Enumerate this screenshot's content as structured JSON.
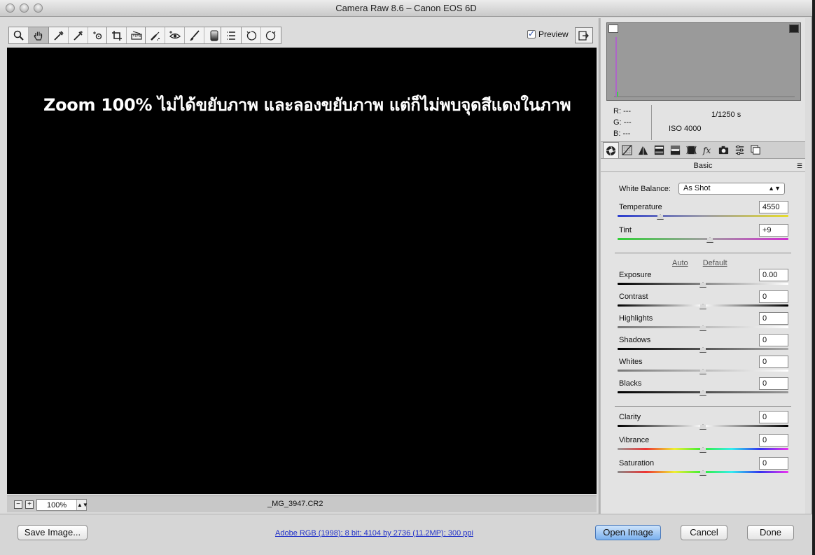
{
  "window": {
    "title": "Camera Raw 8.6  –  Canon EOS 6D"
  },
  "toolbar": {
    "tools": [
      {
        "name": "zoom-tool-icon"
      },
      {
        "name": "hand-tool-icon"
      },
      {
        "name": "white-balance-tool-icon"
      },
      {
        "name": "color-sampler-tool-icon"
      },
      {
        "name": "targeted-adjustment-tool-icon"
      },
      {
        "name": "crop-tool-icon"
      },
      {
        "name": "straighten-tool-icon"
      },
      {
        "name": "spot-removal-tool-icon"
      },
      {
        "name": "red-eye-removal-tool-icon"
      },
      {
        "name": "adjustment-brush-icon"
      },
      {
        "name": "graduated-filter-icon"
      },
      {
        "name": "preferences-icon"
      },
      {
        "name": "rotate-ccw-icon"
      },
      {
        "name": "rotate-cw-icon"
      }
    ],
    "preview_label": "Preview",
    "preview_checked": true
  },
  "canvas": {
    "overlay_text": "Zoom 100% ไม่ได้ขยับภาพ และลองขยับภาพ แต่ก็ไม่พบจุดสีแดงในภาพ",
    "background": "#000000"
  },
  "statusbar": {
    "zoom_out": "−",
    "zoom_in": "+",
    "zoom_value": "100%",
    "filename": "_MG_3947.CR2"
  },
  "histogram": {
    "r_label": "R:",
    "r_value": "---",
    "g_label": "G:",
    "g_value": "---",
    "b_label": "B:",
    "b_value": "---",
    "shutter": "1/1250 s",
    "iso": "ISO 4000"
  },
  "panel": {
    "title": "Basic",
    "tabs": [
      {
        "name": "basic-tab-icon"
      },
      {
        "name": "tone-curve-tab-icon"
      },
      {
        "name": "detail-tab-icon"
      },
      {
        "name": "hsl-tab-icon"
      },
      {
        "name": "split-toning-tab-icon"
      },
      {
        "name": "lens-corrections-tab-icon"
      },
      {
        "name": "effects-tab-icon"
      },
      {
        "name": "camera-calibration-tab-icon"
      },
      {
        "name": "presets-tab-icon"
      },
      {
        "name": "snapshots-tab-icon"
      }
    ],
    "white_balance_label": "White Balance:",
    "white_balance_value": "As Shot",
    "auto_label": "Auto",
    "default_label": "Default",
    "sliders": [
      {
        "label": "Temperature",
        "value": "4550",
        "pos": 0.25
      },
      {
        "label": "Tint",
        "value": "+9",
        "pos": 0.54
      },
      {
        "label": "Exposure",
        "value": "0.00",
        "pos": 0.5
      },
      {
        "label": "Contrast",
        "value": "0",
        "pos": 0.5
      },
      {
        "label": "Highlights",
        "value": "0",
        "pos": 0.5
      },
      {
        "label": "Shadows",
        "value": "0",
        "pos": 0.5
      },
      {
        "label": "Whites",
        "value": "0",
        "pos": 0.5
      },
      {
        "label": "Blacks",
        "value": "0",
        "pos": 0.5
      },
      {
        "label": "Clarity",
        "value": "0",
        "pos": 0.5
      },
      {
        "label": "Vibrance",
        "value": "0",
        "pos": 0.5
      },
      {
        "label": "Saturation",
        "value": "0",
        "pos": 0.5
      }
    ]
  },
  "bottom": {
    "save_label": "Save Image...",
    "info_link": "Adobe RGB (1998); 8 bit; 4104 by 2736 (11.2MP); 300 ppi",
    "open_label": "Open Image",
    "cancel_label": "Cancel",
    "done_label": "Done"
  }
}
